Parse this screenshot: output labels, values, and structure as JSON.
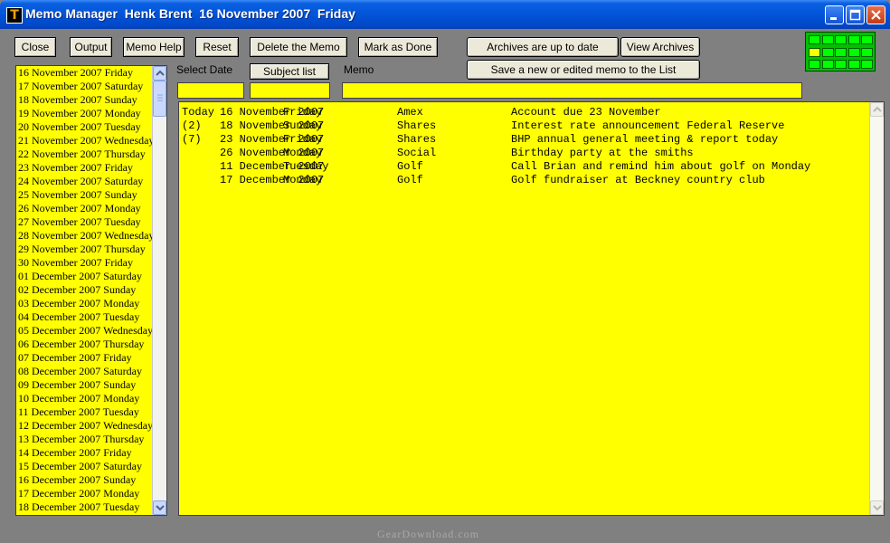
{
  "window": {
    "title": "Memo Manager  Henk Brent  16 November 2007  Friday"
  },
  "toolbar": {
    "close": "Close",
    "output": "Output",
    "memo_help": "Memo Help",
    "reset": "Reset",
    "delete_memo": "Delete the Memo",
    "mark_done": "Mark as Done",
    "archives_status": "Archives are up to date",
    "view_archives": "View Archives",
    "save_memo": "Save a new or edited memo to the List",
    "subject_list": "Subject list"
  },
  "fields": {
    "select_date_label": "Select Date",
    "memo_label": "Memo",
    "select_date_value": "",
    "subject_value": "",
    "memo_value": ""
  },
  "dates": [
    "16 November 2007  Friday",
    "17 November 2007  Saturday",
    "18 November 2007  Sunday",
    "19 November 2007  Monday",
    "20 November 2007  Tuesday",
    "21 November 2007  Wednesday",
    "22 November 2007  Thursday",
    "23 November 2007  Friday",
    "24 November 2007  Saturday",
    "25 November 2007  Sunday",
    "26 November 2007  Monday",
    "27 November 2007  Tuesday",
    "28 November 2007  Wednesday",
    "29 November 2007  Thursday",
    "30 November 2007  Friday",
    "01 December 2007  Saturday",
    "02 December 2007  Sunday",
    "03 December 2007  Monday",
    "04 December 2007  Tuesday",
    "05 December 2007  Wednesday",
    "06 December 2007  Thursday",
    "07 December 2007  Friday",
    "08 December 2007  Saturday",
    "09 December 2007  Sunday",
    "10 December 2007  Monday",
    "11 December 2007  Tuesday",
    "12 December 2007  Wednesday",
    "13 December 2007  Thursday",
    "14 December 2007  Friday",
    "15 December 2007  Saturday",
    "16 December 2007  Sunday",
    "17 December 2007  Monday",
    "18 December 2007  Tuesday"
  ],
  "memos": [
    {
      "prefix": "Today",
      "date": "16 November 2007",
      "day": "Friday",
      "subject": "Amex",
      "text": "Account due 23 November"
    },
    {
      "prefix": "(2)",
      "date": "18 November 2007",
      "day": "Sunday",
      "subject": "Shares",
      "text": "Interest rate announcement Federal Reserve"
    },
    {
      "prefix": "(7)",
      "date": "23 November 2007",
      "day": "Friday",
      "subject": "Shares",
      "text": "BHP annual general meeting & report today"
    },
    {
      "prefix": "",
      "date": "26 November 2007",
      "day": "Monday",
      "subject": "Social",
      "text": "Birthday party at the smiths"
    },
    {
      "prefix": "",
      "date": "11 December 2007",
      "day": "Tuesday",
      "subject": "Golf",
      "text": "Call Brian and remind him about golf on Monday"
    },
    {
      "prefix": "",
      "date": "17 December 2007",
      "day": "Monday",
      "subject": "Golf",
      "text": "Golf fundraiser at Beckney country club"
    }
  ],
  "indicator": {
    "active_row": 1,
    "active_col": 0
  },
  "watermark": "GearDownload.com",
  "colors": {
    "field_bg": "#ffff00",
    "indicator_bg": "#00c000"
  }
}
